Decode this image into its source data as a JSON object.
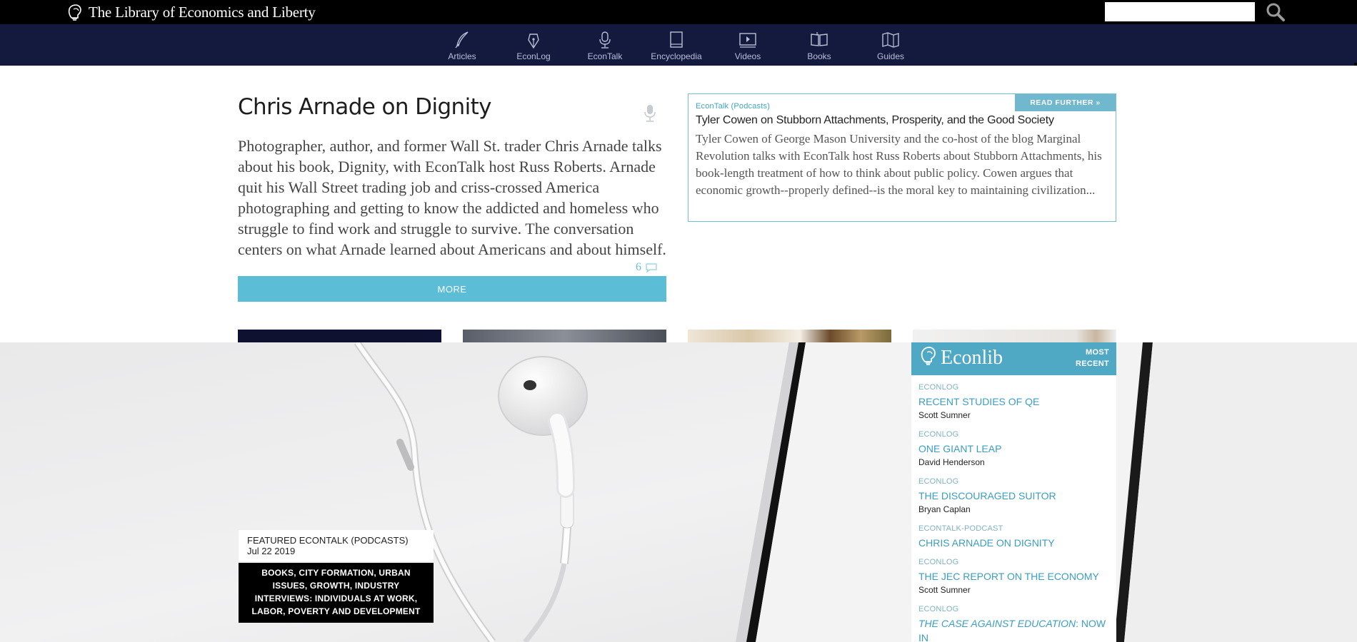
{
  "header": {
    "site_name": "The Library of Economics and Liberty",
    "search_placeholder": ""
  },
  "nav": [
    {
      "label": "Articles",
      "icon": "quill-icon"
    },
    {
      "label": "EconLog",
      "icon": "pen-nib-icon"
    },
    {
      "label": "EconTalk",
      "icon": "microphone-icon"
    },
    {
      "label": "Encyclopedia",
      "icon": "book-icon"
    },
    {
      "label": "Videos",
      "icon": "video-icon"
    },
    {
      "label": "Books",
      "icon": "open-book-icon"
    },
    {
      "label": "Guides",
      "icon": "map-icon"
    }
  ],
  "article": {
    "title": "Chris Arnade on Dignity",
    "summary": "Photographer, author, and former Wall St. trader Chris Arnade talks about his book, Dignity, with EconTalk host Russ Roberts. Arnade quit his Wall Street trading job and criss-crossed America photographing and getting to know the addicted and homeless who struggle to find work and struggle to survive. The conversation centers on what Arnade learned about Americans and about himself.",
    "comment_count": "6",
    "more_label": "MORE"
  },
  "read_further": {
    "category": "EconTalk (Podcasts)",
    "button": "READ FURTHER »",
    "title": "Tyler Cowen on Stubborn Attachments, Prosperity, and the Good Society",
    "description": "Tyler Cowen of George Mason University and the co-host of the blog Marginal Revolution talks with EconTalk host Russ Roberts about Stubborn Attachments, his book-length treatment of how to think about public policy. Cowen argues that economic growth--properly defined--is the moral key to maintaining civilization..."
  },
  "featured": {
    "label": "FEATURED ECONTALK (PODCASTS)",
    "date": "Jul 22 2019",
    "tags": "BOOKS, CITY FORMATION, URBAN ISSUES, GROWTH, INDUSTRY INTERVIEWS: INDIVIDUALS AT WORK, LABOR, POVERTY AND DEVELOPMENT"
  },
  "sidebar": {
    "brand": "Econlib",
    "most": "MOST",
    "recent": "RECENT",
    "items": [
      {
        "category": "ECONLOG",
        "title": "RECENT STUDIES OF QE",
        "author": "Scott Sumner"
      },
      {
        "category": "ECONLOG",
        "title": "ONE GIANT LEAP",
        "author": "David Henderson"
      },
      {
        "category": "ECONLOG",
        "title": "THE DISCOURAGED SUITOR",
        "author": "Bryan Caplan"
      },
      {
        "category": "ECONTALK-PODCAST",
        "title": "CHRIS ARNADE ON DIGNITY",
        "author": ""
      },
      {
        "category": "ECONLOG",
        "title": "THE JEC REPORT ON THE ECONOMY",
        "author": "Scott Sumner"
      },
      {
        "category": "ECONLOG",
        "title_italic": "THE CASE AGAINST EDUCATION",
        "title_rest": ": NOW IN",
        "author": ""
      }
    ]
  },
  "colors": {
    "topbar": "#000000",
    "navbar": "#141a3e",
    "accent": "#5bbdd6",
    "link": "#3a9ec0",
    "tag_box": "#000000"
  }
}
